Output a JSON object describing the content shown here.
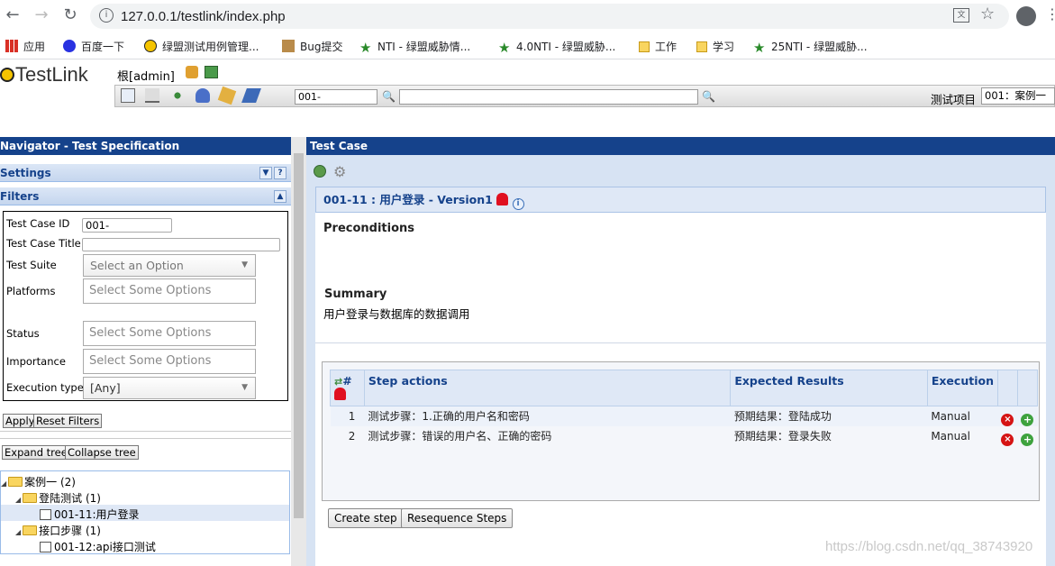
{
  "browser": {
    "url": "127.0.0.1/testlink/index.php",
    "bookmarks": [
      {
        "label": "应用",
        "icon": "apps-icon"
      },
      {
        "label": "百度一下",
        "icon": "baidu-icon"
      },
      {
        "label": "绿盟测试用例管理...",
        "icon": "nsfocus-icon"
      },
      {
        "label": "Bug提交",
        "icon": "bug-icon"
      },
      {
        "label": "NTI - 绿盟威胁情...",
        "icon": "star-icon"
      },
      {
        "label": "4.0NTI - 绿盟威胁...",
        "icon": "star-icon"
      },
      {
        "label": "工作",
        "icon": "folder-icon"
      },
      {
        "label": "学习",
        "icon": "folder-icon"
      },
      {
        "label": "25NTI - 绿盟威胁...",
        "icon": "star-icon"
      }
    ]
  },
  "header": {
    "logo": "TestLink",
    "user": "根[admin]",
    "search_value": "001-",
    "search2_value": "",
    "project_label": "测试项目",
    "project_value": "001：案例一"
  },
  "left": {
    "title": "Navigator - Test Specification",
    "settings": "Settings",
    "filters": "Filters",
    "filter_labels": {
      "tc_id": "Test Case ID",
      "tc_title": "Test Case Title",
      "suite": "Test Suite",
      "platforms": "Platforms",
      "status": "Status",
      "importance": "Importance",
      "exec_type": "Execution type"
    },
    "filter_values": {
      "tc_id": "001-",
      "tc_title": "",
      "suite": "Select an Option",
      "platforms": "Select Some Options",
      "status": "Select Some Options",
      "importance": "Select Some Options",
      "exec_type": "[Any]"
    },
    "apply": "Apply",
    "reset": "Reset Filters",
    "expand": "Expand tree",
    "collapse": "Collapse tree",
    "tree": [
      {
        "label": "案例一 (2)",
        "type": "folder",
        "level": 0
      },
      {
        "label": "登陆测试 (1)",
        "type": "folder",
        "level": 1
      },
      {
        "label": "001-11:用户登录",
        "type": "testcase",
        "level": 2
      },
      {
        "label": "接口步骤 (1)",
        "type": "folder",
        "level": 1
      },
      {
        "label": "001-12:api接口测试",
        "type": "testcase",
        "level": 2
      }
    ]
  },
  "right": {
    "title": "Test Case",
    "tc_header": "001-11 : 用户登录 - Version1",
    "preconditions_label": "Preconditions",
    "summary_label": "Summary",
    "summary_text": "用户登录与数据库的数据调用",
    "columns": [
      "#",
      "Step actions",
      "Expected Results",
      "Execution"
    ],
    "steps": [
      {
        "num": "1",
        "action": "测试步骤：1.正确的用户名和密码",
        "expected": "预期结果：登陆成功",
        "execution": "Manual"
      },
      {
        "num": "2",
        "action": "测试步骤：错误的用户名、正确的密码",
        "expected": "预期结果：登录失败",
        "execution": "Manual"
      }
    ],
    "create_step": "Create step",
    "resequence": "Resequence Steps"
  },
  "watermark": "https://blog.csdn.net/qq_38743920",
  "colors": {
    "panel_title": "#15428b",
    "right_bg": "#d7e3f3"
  }
}
